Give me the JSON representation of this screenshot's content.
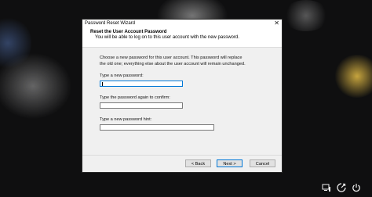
{
  "window": {
    "title": "Password Reset Wizard",
    "close_glyph": "✕"
  },
  "header": {
    "title": "Reset the User Account Password",
    "subtitle": "You will be able to log on to this user account with the new password."
  },
  "content": {
    "description_line1": "Choose a new password for this user account. This password will replace",
    "description_line2": "the old one; everything else about the user account will remain unchanged.",
    "new_password_label": "Type a new password:",
    "new_password_value": "",
    "confirm_label": "Type the password again to confirm:",
    "confirm_value": "",
    "hint_label": "Type a new password hint:",
    "hint_value": ""
  },
  "buttons": {
    "back": "< Back",
    "next": "Next >",
    "cancel": "Cancel"
  },
  "tray": {
    "icons": [
      "network-icon",
      "accessibility-icon",
      "power-icon"
    ],
    "network_glyph": "🖧",
    "accessibility_glyph": "⟲",
    "power_glyph": "⏻"
  }
}
